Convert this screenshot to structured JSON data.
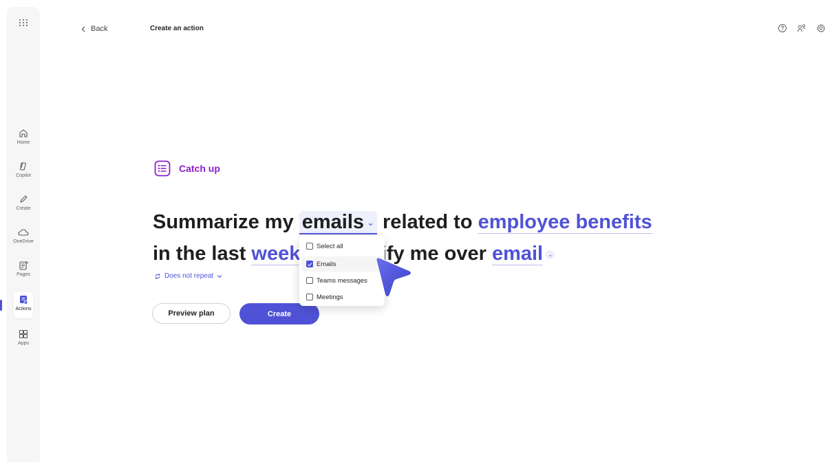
{
  "nav": {
    "items": [
      {
        "label": "Home",
        "icon": "home-icon"
      },
      {
        "label": "Copilot",
        "icon": "copilot-icon"
      },
      {
        "label": "Create",
        "icon": "pen-icon"
      },
      {
        "label": "OneDrive",
        "icon": "cloud-icon"
      },
      {
        "label": "Pages",
        "icon": "pages-icon"
      },
      {
        "label": "Actions",
        "icon": "actions-icon",
        "active": true
      },
      {
        "label": "Apps",
        "icon": "apps-icon"
      }
    ]
  },
  "header": {
    "back_label": "Back",
    "title": "Create an action"
  },
  "template": {
    "label": "Catch up"
  },
  "sentence": {
    "part1": "Summarize my ",
    "slot_content": "emails",
    "part2": " related to ",
    "slot_topic": "employee benefits",
    "part3": "in the last ",
    "slot_time": "week",
    "part4": "otify me over ",
    "slot_channel": "email"
  },
  "repeat": {
    "label": "Does not repeat"
  },
  "buttons": {
    "preview": "Preview plan",
    "create": "Create"
  },
  "dropdown": {
    "options": [
      {
        "label": "Select all",
        "checked": false
      },
      {
        "label": "Emails",
        "checked": true
      },
      {
        "label": "Teams messages",
        "checked": false
      },
      {
        "label": "Meetings",
        "checked": false
      }
    ]
  },
  "colors": {
    "accent": "#4f52d6",
    "catchup": "#8b1ec9"
  }
}
